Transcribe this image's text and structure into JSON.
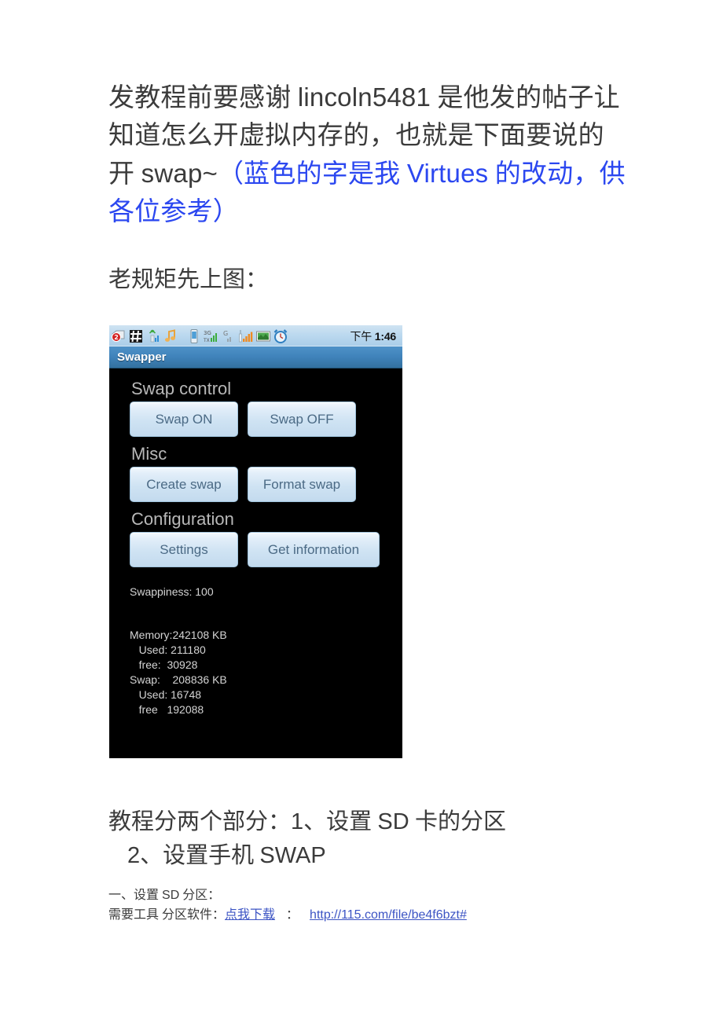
{
  "document": {
    "intro_paragraph": {
      "seg1": "发教程前要感谢 ",
      "seg2_latin": "lincoln5481",
      "seg3": " 是他发的帖子让知道怎么开虚拟内存的，也就是下面要说的开 ",
      "seg4_latin": "swap~",
      "seg5_blue": "（蓝色的字是我 ",
      "seg6_blue_latin": "Virtues",
      "seg7_blue": " 的改动，供各位参考）"
    },
    "subheading": "老规矩先上图：",
    "section_heading": {
      "line1_a": "教程分两个部分：",
      "line1_b_latin": "1",
      "line1_c": "、设置 ",
      "line1_d_latin": "SD",
      "line1_e": " 卡的分区",
      "line2_a_latin": "2",
      "line2_b": "、设置手机 ",
      "line2_c_latin": "SWAP"
    },
    "small_lines": {
      "line1_a": "一、设置 ",
      "line1_b_latin": "SD",
      "line1_c": " 分区：",
      "line2_prefix": "需要工具  分区软件：",
      "line2_link_text": "点我下载",
      "line2_separator": "：",
      "line2_url": "http://115.com/file/be4f6bzt#"
    }
  },
  "phone_screenshot": {
    "statusbar": {
      "time": "下午 1:46",
      "time_meridiem": "下午",
      "time_clock": "1:46",
      "icons": [
        "sms-unread-badge-icon",
        "hash-keypad-icon",
        "wifi-signal-icon",
        "music-note-icon",
        "phone-device-icon",
        "3g-data-signal-icon",
        "cell-signal-icon",
        "g-network-icon",
        "photo-gallery-icon",
        "alarm-clock-icon"
      ],
      "sms_badge_count": "2"
    },
    "titlebar": {
      "app_title": "Swapper"
    },
    "groups": [
      {
        "title": "Swap control",
        "buttons": [
          "Swap ON",
          "Swap OFF"
        ]
      },
      {
        "title": "Misc",
        "buttons": [
          "Create swap",
          "Format swap"
        ]
      },
      {
        "title": "Configuration",
        "buttons": [
          "Settings",
          "Get information"
        ]
      }
    ],
    "info": {
      "swappiness_line": "Swappiness: 100",
      "memory_line": "Memory:242108 KB",
      "memory_used_line": "   Used: 211180",
      "memory_free_line": "   free:  30928",
      "swap_line": "Swap:    208836 KB",
      "swap_used_line": "   Used: 16748",
      "swap_free_line": "   free   192088"
    }
  },
  "colors": {
    "link_blue": "#3c54c4",
    "accent_blue": "#2b47f0",
    "titlebar_blue": "#3f82ba",
    "app_background": "#000000",
    "button_face": "#cfe3f3",
    "button_text": "#4b6a85",
    "group_title_gray": "#b8b8b8",
    "info_text_gray": "#d4d4d4",
    "body_text": "#3b3b3b"
  }
}
